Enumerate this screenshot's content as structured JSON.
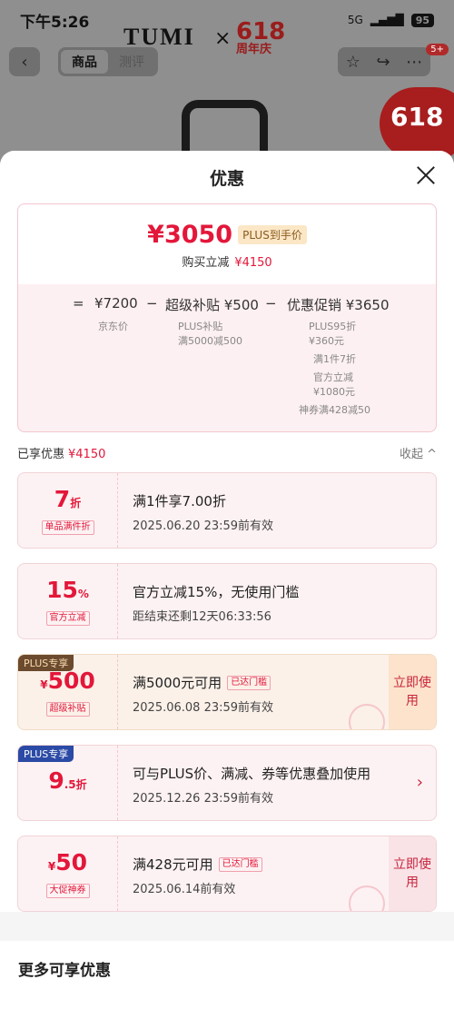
{
  "status_bar": {
    "time": "下午5:26",
    "network": "5G",
    "battery": "95"
  },
  "nav": {
    "tab_product": "商品",
    "tab_review": "测评",
    "cart_badge": "5+"
  },
  "background": {
    "brand": "TUMI",
    "cross": "×",
    "promo_num": "618",
    "promo_text": "周年庆",
    "circle_badge": "618"
  },
  "sheet": {
    "title": "优惠"
  },
  "price": {
    "final_price": "¥3050",
    "plus_tag": "PLUS到手价",
    "instant_label": "购买立减",
    "instant_value": "¥4150",
    "formula": {
      "eq": "=",
      "jd_price": "¥7200",
      "minus1": "−",
      "subsidy": "超级补贴 ¥500",
      "minus2": "−",
      "promo": "优惠促销 ¥3650",
      "jd_label": "京东价",
      "subsidy_sub1": "PLUS补贴",
      "subsidy_sub2": "满5000减500",
      "promo_sub": [
        "PLUS95折",
        "¥360元",
        "满1件7折",
        "官方立减",
        "¥1080元",
        "神券满428减50"
      ]
    }
  },
  "enjoyed": {
    "label": "已享优惠",
    "value": "¥4150",
    "collapse": "收起 ^"
  },
  "coupons": [
    {
      "value": "7",
      "unit": "折",
      "tag": "单品满件折",
      "title": "满1件享7.00折",
      "sub": "2025.06.20 23:59前有效"
    },
    {
      "value": "15",
      "unit": "%",
      "tag": "官方立减",
      "title": "官方立减15%，无使用门槛",
      "sub": "距结束还剩12天06:33:56"
    },
    {
      "badge": "PLUS专享",
      "prefix": "¥",
      "value": "500",
      "tag": "超级补贴",
      "title": "满5000元可用",
      "reach": "已达门槛",
      "sub": "2025.06.08 23:59前有效",
      "action": "立即使用"
    },
    {
      "badge": "PLUS专享",
      "value": "9",
      "unit": ".5折",
      "title": "可与PLUS价、满减、券等优惠叠加使用",
      "sub": "2025.12.26 23:59前有效",
      "chevron": "›"
    },
    {
      "prefix": "¥",
      "value": "50",
      "tag": "大促神券",
      "title": "满428元可用",
      "reach": "已达门槛",
      "sub": "2025.06.14前有效",
      "action": "立即使用"
    }
  ],
  "more": {
    "title": "更多可享优惠"
  }
}
